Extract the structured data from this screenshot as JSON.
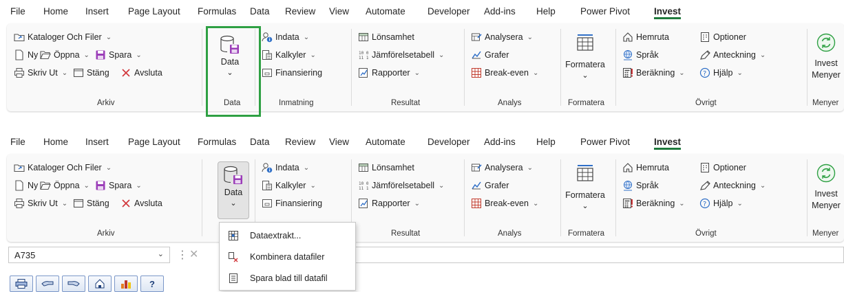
{
  "menu": [
    "File",
    "Home",
    "Insert",
    "Page Layout",
    "Formulas",
    "Data",
    "Review",
    "View",
    "Automate",
    "Developer",
    "Add-ins",
    "Help",
    "Power Pivot",
    "Invest"
  ],
  "active_tab": "Invest",
  "ribbon": {
    "arkiv": {
      "kataloger": "Kataloger Och Filer",
      "ny": "Ny",
      "oppna": "Öppna",
      "spara": "Spara",
      "skriv_ut": "Skriv Ut",
      "stang": "Stäng",
      "avsluta": "Avsluta",
      "group": "Arkiv"
    },
    "data": {
      "button": "Data",
      "group": "Data"
    },
    "inmatning": {
      "indata": "Indata",
      "kalkyler": "Kalkyler",
      "finansiering": "Finansiering",
      "group": "Inmatning"
    },
    "resultat": {
      "lonsamhet": "Lönsamhet",
      "jamforelse": "Jämförelsetabell",
      "rapporter": "Rapporter",
      "group": "Resultat"
    },
    "analys": {
      "analysera": "Analysera",
      "grafer": "Grafer",
      "break_even": "Break-even",
      "group": "Analys"
    },
    "formatera": {
      "button": "Formatera",
      "group": "Formatera"
    },
    "ovrigt": {
      "hemruta": "Hemruta",
      "sprak": "Språk",
      "berakning": "Beräkning",
      "optioner": "Optioner",
      "anteckning": "Anteckning",
      "hjalp": "Hjälp",
      "group": "Övrigt"
    },
    "menyer": {
      "button_line1": "Invest",
      "button_line2": "Menyer",
      "group": "Menyer"
    }
  },
  "namebox": {
    "value": "A735"
  },
  "dropdown": {
    "items": [
      "Dataextrakt...",
      "Kombinera datafiler",
      "Spara blad till datafil"
    ]
  },
  "toolbar": {
    "icons": [
      "printer-icon",
      "back-hand-icon",
      "forward-hand-icon",
      "home-icon",
      "chart-icon",
      "help-icon"
    ],
    "help_label": "?"
  },
  "colors": {
    "highlight": "#2ea043",
    "accent": "#1f7a3c",
    "ribbon_bg": "#f9f9f9",
    "purple": "#9b3db8"
  }
}
